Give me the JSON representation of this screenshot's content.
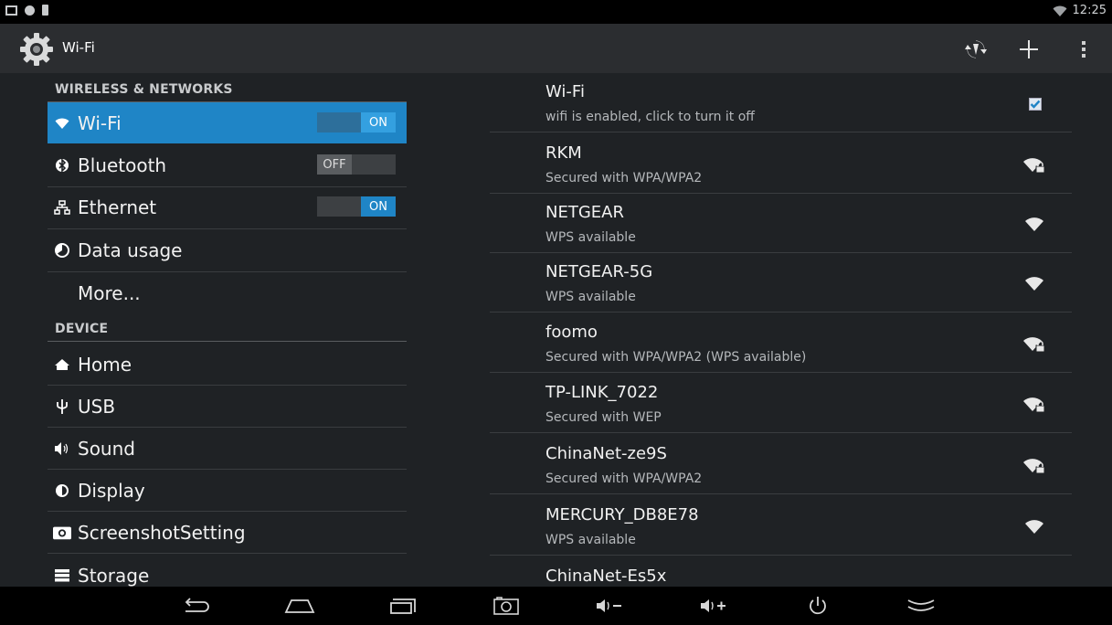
{
  "status_bar": {
    "time": "12:25"
  },
  "action_bar": {
    "title": "Wi-Fi"
  },
  "left_panel": {
    "categories": [
      "WIRELESS & NETWORKS",
      "DEVICE"
    ],
    "items": [
      {
        "label": "Wi-Fi",
        "icon": "wifi-icon",
        "toggle": "ON"
      },
      {
        "label": "Bluetooth",
        "icon": "bluetooth-icon",
        "toggle": "OFF"
      },
      {
        "label": "Ethernet",
        "icon": "ethernet-icon",
        "toggle": "ON"
      },
      {
        "label": "Data usage",
        "icon": "data-usage-icon"
      },
      {
        "label": "More..."
      },
      {
        "label": "Home",
        "icon": "home-icon"
      },
      {
        "label": "USB",
        "icon": "usb-icon"
      },
      {
        "label": "Sound",
        "icon": "sound-icon"
      },
      {
        "label": "Display",
        "icon": "display-icon"
      },
      {
        "label": "ScreenshotSetting",
        "icon": "camera-icon"
      },
      {
        "label": "Storage",
        "icon": "storage-icon"
      }
    ]
  },
  "right_panel": {
    "wifi_header": {
      "title": "Wi-Fi",
      "subtitle": "wifi is enabled, click to turn it off",
      "checked": true
    },
    "networks": [
      {
        "name": "RKM",
        "status": "Secured with WPA/WPA2",
        "secured": true
      },
      {
        "name": "NETGEAR",
        "status": "WPS available",
        "secured": false
      },
      {
        "name": "NETGEAR-5G",
        "status": "WPS available",
        "secured": false
      },
      {
        "name": "foomo",
        "status": "Secured with WPA/WPA2 (WPS available)",
        "secured": true
      },
      {
        "name": "TP-LINK_7022",
        "status": "Secured with WEP",
        "secured": true
      },
      {
        "name": "ChinaNet-ze9S",
        "status": "Secured with WPA/WPA2",
        "secured": true
      },
      {
        "name": "MERCURY_DB8E78",
        "status": "WPS available",
        "secured": false
      },
      {
        "name": "ChinaNet-Es5x",
        "status": "",
        "secured": true
      }
    ]
  },
  "colors": {
    "accent": "#1f85c6",
    "background": "#1f2225",
    "action_bar": "#2b2d30"
  }
}
